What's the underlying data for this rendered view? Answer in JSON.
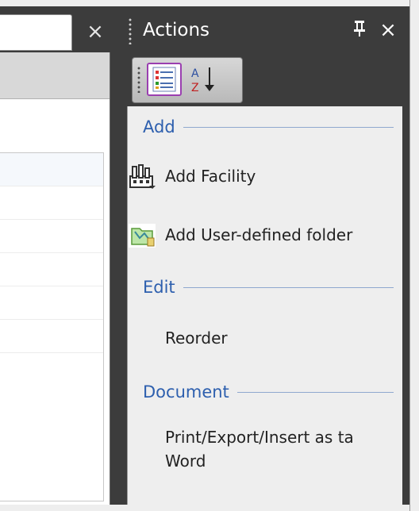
{
  "left_pane": {
    "close_glyph": "×"
  },
  "actions_pane": {
    "title": "Actions",
    "pin_glyph": "ᵩ",
    "close_glyph": "×",
    "toolbar": {
      "categorized_icon": "categorized-list-icon",
      "sort_icon": "sort-az-icon",
      "sort_letters": "A Z"
    },
    "groups": [
      {
        "title": "Add",
        "items": [
          {
            "label": "Add Facility",
            "icon": "facility-icon"
          },
          {
            "label": "Add User-defined folder",
            "icon": "folder-icon"
          }
        ]
      },
      {
        "title": "Edit",
        "items": [
          {
            "label": "Reorder"
          }
        ]
      },
      {
        "title": "Document",
        "items": [
          {
            "label": "Print/Export/Insert as ta\nWord"
          }
        ]
      }
    ]
  },
  "colors": {
    "background": "#3c3c3c",
    "group_title": "#2d5fae",
    "panel": "#eeeeee",
    "selected_toolbar_border": "#9a3fb0"
  }
}
